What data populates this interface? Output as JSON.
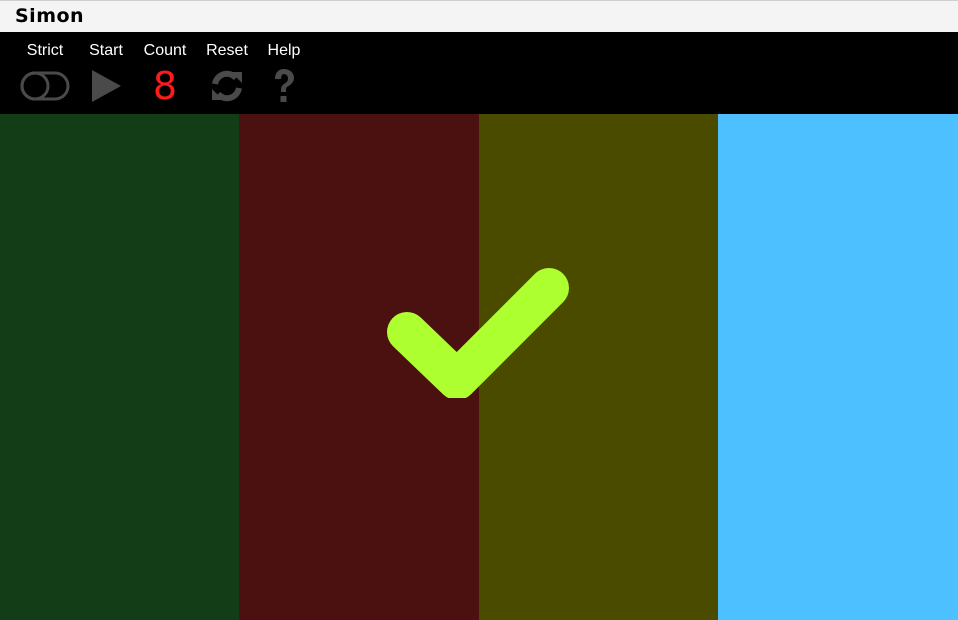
{
  "app": {
    "title": "Simon"
  },
  "controls": {
    "strict": {
      "label": "Strict",
      "icon": "toggle-off-icon",
      "enabled": false
    },
    "start": {
      "label": "Start",
      "icon": "play-icon"
    },
    "count": {
      "label": "Count",
      "value": "8"
    },
    "reset": {
      "label": "Reset",
      "icon": "refresh-icon"
    },
    "help": {
      "label": "Help",
      "icon": "question-icon"
    }
  },
  "colors": {
    "green_pad": "#123d16",
    "red_pad": "#4b1010",
    "yellow_pad": "#4b4b00",
    "blue_pad": "#4dc0ff",
    "checkmark": "#adff2f",
    "count": "#ff1a1a",
    "icon_gray": "#4a4a4a"
  },
  "board": {
    "pads": [
      {
        "name": "green",
        "state": "dim"
      },
      {
        "name": "red",
        "state": "dim"
      },
      {
        "name": "yellow",
        "state": "dim"
      },
      {
        "name": "blue",
        "state": "lit"
      }
    ],
    "overlay": "checkmark-icon"
  }
}
